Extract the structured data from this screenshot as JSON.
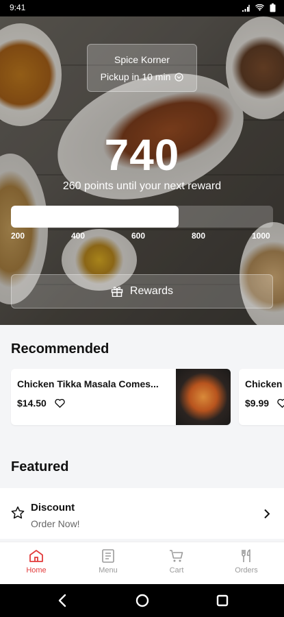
{
  "status_bar": {
    "time": "9:41"
  },
  "store": {
    "name": "Spice Korner",
    "pickup": "Pickup in 10 min"
  },
  "points": {
    "value": "740",
    "subtitle": "260 points until your next reward",
    "progress_fraction": 0.64
  },
  "progress_ticks": [
    "200",
    "400",
    "600",
    "800",
    "1000"
  ],
  "rewards_button": {
    "label": "Rewards"
  },
  "recommended": {
    "title": "Recommended",
    "items": [
      {
        "name": "Chicken Tikka Masala Comes...",
        "price": "$14.50"
      },
      {
        "name": "Chicken",
        "price": "$9.99"
      }
    ]
  },
  "featured": {
    "title": "Featured",
    "items": [
      {
        "title": "Discount",
        "subtitle": "Order Now!"
      }
    ]
  },
  "tabs": [
    {
      "label": "Home",
      "icon": "home-icon",
      "active": true
    },
    {
      "label": "Menu",
      "icon": "menu-icon",
      "active": false
    },
    {
      "label": "Cart",
      "icon": "cart-icon",
      "active": false
    },
    {
      "label": "Orders",
      "icon": "orders-icon",
      "active": false
    }
  ],
  "colors": {
    "accent": "#e23a3a",
    "inactive": "#9a9a9a"
  }
}
